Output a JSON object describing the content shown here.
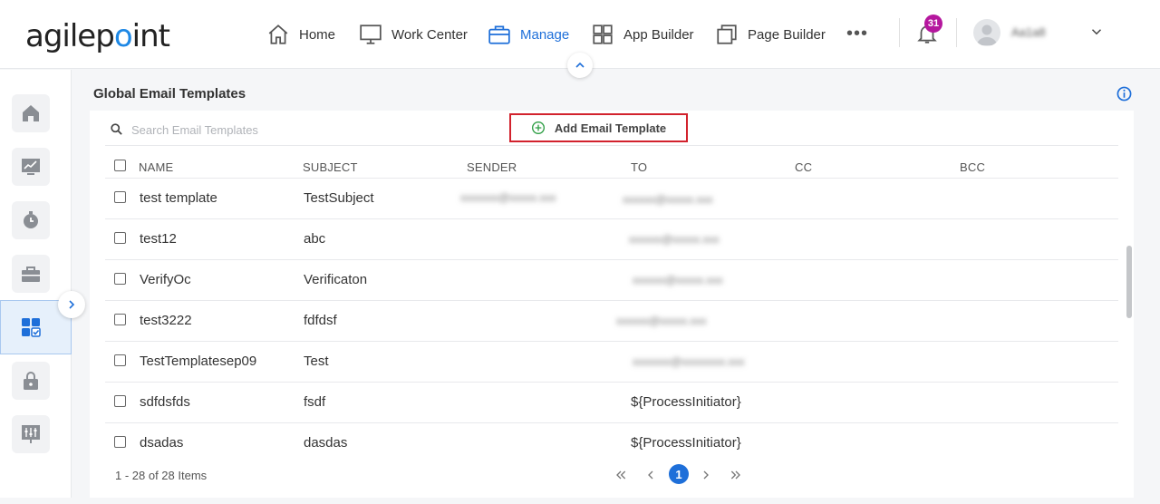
{
  "brand": {
    "logo_text_a": "agilep",
    "logo_text_b": "int"
  },
  "nav": {
    "items": [
      {
        "label": "Home",
        "icon": "home-icon"
      },
      {
        "label": "Work Center",
        "icon": "monitor-icon"
      },
      {
        "label": "Manage",
        "icon": "briefcase-icon",
        "active": true
      },
      {
        "label": "App Builder",
        "icon": "grid-icon"
      },
      {
        "label": "Page Builder",
        "icon": "pages-icon"
      }
    ],
    "more": "•••",
    "notifications_count": "31",
    "username": "Aa1a8"
  },
  "page": {
    "title": "Global Email Templates"
  },
  "search": {
    "placeholder": "Search Email Templates"
  },
  "toolbar": {
    "add_label": "Add Email Template"
  },
  "table": {
    "columns": [
      "NAME",
      "SUBJECT",
      "SENDER",
      "TO",
      "CC",
      "BCC"
    ],
    "rows": [
      {
        "name": "test template",
        "subject": "TestSubject",
        "sender": "xxxxxxx@xxxxx.xxx",
        "to": "xxxxxx@xxxxx.xxx",
        "cc": "",
        "bcc": ""
      },
      {
        "name": "test12",
        "subject": "abc",
        "sender": "",
        "to": "xxxxxx@xxxxx.xxx",
        "cc": "",
        "bcc": ""
      },
      {
        "name": "VerifyOc",
        "subject": "Verificaton",
        "sender": "",
        "to": "xxxxxx@xxxxx.xxx",
        "cc": "",
        "bcc": ""
      },
      {
        "name": "test3222",
        "subject": "fdfdsf",
        "sender": "",
        "to": "xxxxxx@xxxxx.xxx",
        "cc": "",
        "bcc": ""
      },
      {
        "name": "TestTemplatesep09",
        "subject": "Test",
        "sender": "",
        "to": "xxxxxxx@xxxxxxxx.xxx",
        "cc": "",
        "bcc": ""
      },
      {
        "name": "sdfdsfds",
        "subject": "fsdf",
        "sender": "",
        "to": "${ProcessInitiator}",
        "cc": "",
        "bcc": ""
      },
      {
        "name": "dsadas",
        "subject": "dasdas",
        "sender": "",
        "to": "${ProcessInitiator}",
        "cc": "",
        "bcc": ""
      }
    ]
  },
  "pager": {
    "info": "1 - 28 of 28 Items",
    "current": "1"
  },
  "colors": {
    "accent": "#1e6fd9",
    "highlight_border": "#d2222d",
    "badge": "#b5179e",
    "add_icon": "#2e9e44"
  }
}
